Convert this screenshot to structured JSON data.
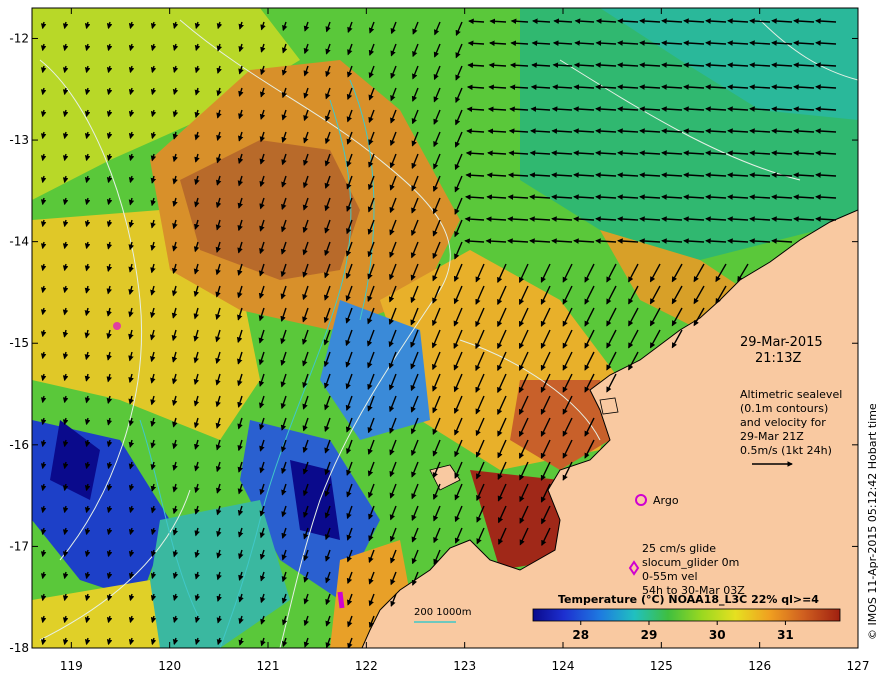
{
  "map": {
    "x_ticks": [
      "119",
      "120",
      "121",
      "122",
      "123",
      "124",
      "125",
      "126",
      "127"
    ],
    "y_ticks": [
      "-12",
      "-13",
      "-14",
      "-15",
      "-16",
      "-17",
      "-18"
    ],
    "lon_range": [
      118.6,
      127.0
    ],
    "lat_range": [
      -18.0,
      -11.7
    ],
    "land_color": "#f9c9a1",
    "background_colors": {
      "dark_orange": "#c87a2a",
      "brown": "#b0622a",
      "green": "#3fbf3f",
      "cyan": "#4fc4b0",
      "blue": "#1d2fd0",
      "yellow": "#d8d820"
    }
  },
  "datetime": {
    "date": "29-Mar-2015",
    "time": "21:13Z"
  },
  "altimetric_note": {
    "line1": "Altimetric sealevel",
    "line2": "(0.1m contours)",
    "line3": "and velocity for",
    "line4": "29-Mar 21Z",
    "line5": "0.5m/s (1kt 24h)"
  },
  "argo": {
    "label": "Argo",
    "color": "#d000d0"
  },
  "glider": {
    "line1": "25 cm/s glide",
    "line2": "slocum_glider 0m",
    "line3": "0-55m vel",
    "line4": "54h to 30-Mar 03Z",
    "color": "#d000d0"
  },
  "bathy_legend": {
    "label": "200  1000m",
    "color": "#40c8c8"
  },
  "colorbar": {
    "title": "Temperature (°C) NOAA18_L3C 22% ql>=4",
    "ticks": [
      "28",
      "29",
      "30",
      "31"
    ],
    "range": [
      27.3,
      31.8
    ],
    "colors": [
      "#0a0a8c",
      "#1d2fd0",
      "#1e7be0",
      "#20c0c0",
      "#3fbf3f",
      "#9ad820",
      "#e6e020",
      "#f0a020",
      "#d06020",
      "#a02010"
    ]
  },
  "side_note": "© IMOS 11-Apr-2015 05:12:42 Hobart time"
}
